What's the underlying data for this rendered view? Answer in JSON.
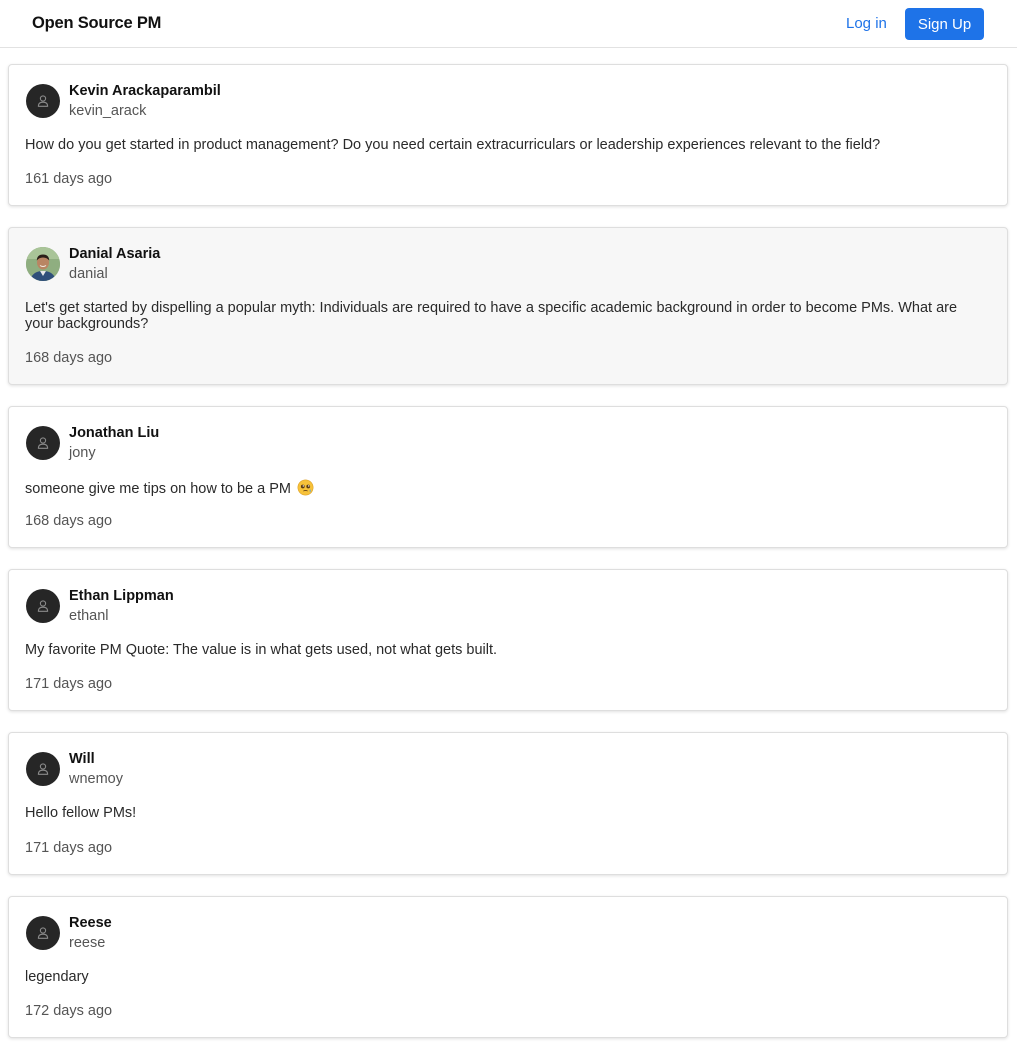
{
  "header": {
    "brand": "Open Source PM",
    "login_label": "Log in",
    "signup_label": "Sign Up"
  },
  "colors": {
    "accent": "#1e73e8",
    "avatar_bg": "#262626",
    "highlight_card_bg": "#f7f7f7"
  },
  "posts": [
    {
      "author": "Kevin Arackaparambil",
      "handle": "kevin_arack",
      "avatar": "person-icon",
      "body": "How do you get started in product management? Do you need certain extracurriculars or leadership experiences relevant to the field?",
      "time": "161 days ago"
    },
    {
      "author": "Danial Asaria",
      "handle": "danial",
      "avatar": "profile-photo",
      "body": "Let's get started by dispelling a popular myth: Individuals are required to have a specific academic background in order to become PMs. What are your backgrounds?",
      "time": "168 days ago"
    },
    {
      "author": "Jonathan Liu",
      "handle": "jony",
      "avatar": "person-icon",
      "body": "someone give me tips on how to be a PM",
      "body_emoji": "pleading-face-emoji",
      "time": "168 days ago"
    },
    {
      "author": "Ethan Lippman",
      "handle": "ethanl",
      "avatar": "person-icon",
      "body": "My favorite PM Quote: The value is in what gets used, not what gets built.",
      "time": "171 days ago"
    },
    {
      "author": "Will",
      "handle": "wnemoy",
      "avatar": "person-icon",
      "body": "Hello fellow PMs!",
      "time": "171 days ago"
    },
    {
      "author": "Reese",
      "handle": "reese",
      "avatar": "person-icon",
      "body": "legendary",
      "time": "172 days ago"
    }
  ]
}
